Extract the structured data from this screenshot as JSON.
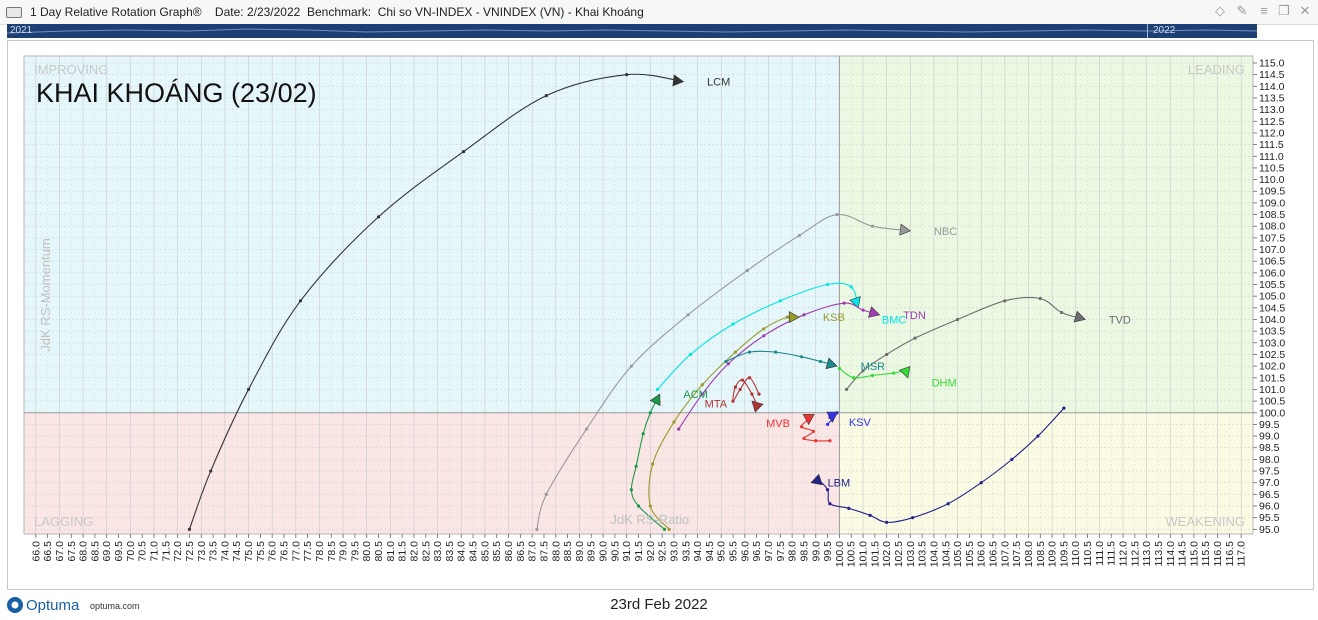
{
  "window": {
    "title": "1 Day Relative Rotation Graph®    Date: 2/23/2022  Benchmark:  Chi so VN-INDEX - VNINDEX (VN) - Khai Khoáng"
  },
  "timeline": {
    "start_label": "2021",
    "end_label": "2022"
  },
  "footer": {
    "brand": "Optuma",
    "url": "optuma.com",
    "date": "23rd Feb 2022"
  },
  "colors": {
    "improving": "#e6f7fb",
    "leading": "#ebf8e2",
    "lagging": "#fbe6e6",
    "weakening": "#fbfbe4",
    "timeline": "#1e3f73",
    "brand": "#1a5ea6"
  },
  "chart_data": {
    "type": "scatter",
    "title": "KHAI KHOÁNG (23/02)",
    "xlabel": "JdK RS-Ratio",
    "ylabel": "JdK RS-Momentum",
    "xlim": [
      65.5,
      117.5
    ],
    "ylim": [
      94.8,
      115.3
    ],
    "center": [
      100,
      100
    ],
    "quadrants": {
      "improving": "IMPROVING",
      "leading": "LEADING",
      "lagging": "LAGGING",
      "weakening": "WEAKENING"
    },
    "series": [
      {
        "name": "LCM",
        "color": "#333333",
        "label_offset": [
          1.0,
          0
        ],
        "points": [
          [
            72.5,
            95.0
          ],
          [
            73.4,
            97.5
          ],
          [
            75.0,
            101.0
          ],
          [
            77.2,
            104.8
          ],
          [
            80.5,
            108.4
          ],
          [
            84.1,
            111.2
          ],
          [
            87.6,
            113.6
          ],
          [
            91.0,
            114.5
          ],
          [
            93.4,
            114.2
          ]
        ]
      },
      {
        "name": "NBC",
        "color": "#999999",
        "label_offset": [
          1.0,
          0
        ],
        "points": [
          [
            87.2,
            95.0
          ],
          [
            87.6,
            96.5
          ],
          [
            89.3,
            99.3
          ],
          [
            91.2,
            102.0
          ],
          [
            93.6,
            104.2
          ],
          [
            96.1,
            106.1
          ],
          [
            98.3,
            107.6
          ],
          [
            99.9,
            108.5
          ],
          [
            101.4,
            108.0
          ],
          [
            103.0,
            107.8
          ]
        ]
      },
      {
        "name": "TVD",
        "color": "#6e6e6e",
        "label_offset": [
          1.0,
          0
        ],
        "points": [
          [
            100.3,
            101.0
          ],
          [
            101.0,
            101.8
          ],
          [
            102.0,
            102.5
          ],
          [
            103.2,
            103.2
          ],
          [
            105.0,
            104.0
          ],
          [
            107.0,
            104.8
          ],
          [
            108.5,
            104.9
          ],
          [
            109.4,
            104.3
          ],
          [
            110.4,
            104.0
          ]
        ]
      },
      {
        "name": "BMC",
        "color": "#00e5e5",
        "label_offset": [
          1.0,
          -0.5
        ],
        "points": [
          [
            92.3,
            101.0
          ],
          [
            93.7,
            102.5
          ],
          [
            95.5,
            103.8
          ],
          [
            97.5,
            104.8
          ],
          [
            99.5,
            105.5
          ],
          [
            100.5,
            105.4
          ],
          [
            100.8,
            104.5
          ]
        ]
      },
      {
        "name": "TDN",
        "color": "#a03bb0",
        "label_offset": [
          1.0,
          0
        ],
        "points": [
          [
            93.2,
            99.3
          ],
          [
            94.2,
            100.8
          ],
          [
            95.3,
            102.1
          ],
          [
            96.8,
            103.3
          ],
          [
            98.5,
            104.2
          ],
          [
            100.2,
            104.7
          ],
          [
            101.0,
            104.4
          ],
          [
            101.7,
            104.2
          ]
        ]
      },
      {
        "name": "KSB",
        "color": "#9a9a2a",
        "label_offset": [
          1.0,
          0
        ],
        "points": [
          [
            92.8,
            95.0
          ],
          [
            92.0,
            96.0
          ],
          [
            92.1,
            97.8
          ],
          [
            93.0,
            99.6
          ],
          [
            94.2,
            101.2
          ],
          [
            95.6,
            102.6
          ],
          [
            96.8,
            103.6
          ],
          [
            97.8,
            104.1
          ],
          [
            98.3,
            104.1
          ]
        ]
      },
      {
        "name": "ACM",
        "color": "#1a9a4a",
        "label_offset": [
          1.0,
          0
        ],
        "points": [
          [
            92.6,
            95.0
          ],
          [
            91.5,
            96.0
          ],
          [
            91.2,
            96.7
          ],
          [
            91.4,
            97.7
          ],
          [
            91.7,
            99.1
          ],
          [
            92.0,
            100.0
          ],
          [
            92.4,
            100.8
          ]
        ]
      },
      {
        "name": "MSR",
        "color": "#1a8a8a",
        "label_offset": [
          1.0,
          0
        ],
        "points": [
          [
            95.2,
            102.2
          ],
          [
            96.2,
            102.6
          ],
          [
            97.3,
            102.6
          ],
          [
            98.4,
            102.4
          ],
          [
            99.2,
            102.2
          ],
          [
            99.9,
            102.0
          ]
        ]
      },
      {
        "name": "DHM",
        "color": "#33dd33",
        "label_offset": [
          1.0,
          -0.2
        ],
        "points": [
          [
            100.0,
            101.9
          ],
          [
            100.6,
            101.5
          ],
          [
            101.4,
            101.6
          ],
          [
            102.3,
            101.7
          ],
          [
            102.8,
            101.8
          ],
          [
            102.9,
            101.5
          ]
        ]
      },
      {
        "name": "MTA",
        "color": "#b03333",
        "label_offset": [
          -2.0,
          -0.1
        ],
        "points": [
          [
            96.6,
            100.8
          ],
          [
            96.2,
            101.5
          ],
          [
            95.8,
            101.0
          ],
          [
            95.5,
            100.5
          ],
          [
            95.6,
            101.1
          ],
          [
            95.9,
            101.4
          ],
          [
            96.3,
            100.8
          ],
          [
            96.5,
            100.3
          ],
          [
            96.3,
            100.5
          ]
        ]
      },
      {
        "name": "MVB",
        "color": "#ee3333",
        "label_offset": [
          -1.8,
          0.05
        ],
        "points": [
          [
            99.6,
            98.8
          ],
          [
            99.0,
            98.8
          ],
          [
            98.5,
            98.9
          ],
          [
            98.9,
            99.2
          ],
          [
            98.4,
            99.4
          ],
          [
            98.7,
            99.7
          ],
          [
            98.7,
            99.5
          ]
        ]
      },
      {
        "name": "KSV",
        "color": "#3333ee",
        "label_offset": [
          0.7,
          0
        ],
        "points": [
          [
            99.5,
            99.5
          ],
          [
            99.9,
            100.0
          ],
          [
            99.6,
            99.8
          ],
          [
            99.7,
            99.7
          ],
          [
            99.7,
            99.6
          ]
        ]
      },
      {
        "name": "LBM",
        "color": "#22228a",
        "label_offset": [
          0.7,
          0
        ],
        "points": [
          [
            109.5,
            100.2
          ],
          [
            108.4,
            99.0
          ],
          [
            107.3,
            98.0
          ],
          [
            106.0,
            97.0
          ],
          [
            104.6,
            96.1
          ],
          [
            103.1,
            95.5
          ],
          [
            102.0,
            95.3
          ],
          [
            101.3,
            95.6
          ],
          [
            100.4,
            95.9
          ],
          [
            99.6,
            96.1
          ],
          [
            99.5,
            96.7
          ],
          [
            99.1,
            97.1
          ],
          [
            98.8,
            97.0
          ]
        ]
      }
    ]
  }
}
